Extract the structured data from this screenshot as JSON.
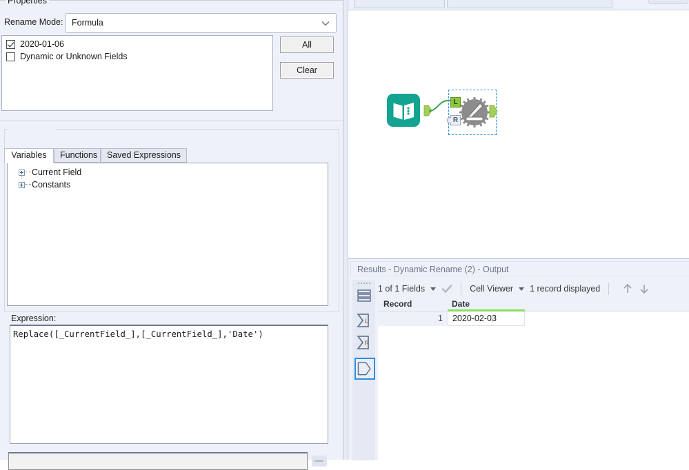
{
  "config": {
    "rename_mode_label": "Rename Mode:",
    "rename_mode_value": "Formula",
    "dropdown_icon": "chevron-down-icon",
    "fields": [
      {
        "label": "2020-01-06",
        "checked": true
      },
      {
        "label": "Dynamic or Unknown Fields",
        "checked": false
      }
    ],
    "buttons": {
      "all": "All",
      "clear": "Clear"
    },
    "properties": {
      "group_title": "Properties",
      "tabs": [
        {
          "label": "Variables",
          "active": true
        },
        {
          "label": "Functions",
          "active": false
        },
        {
          "label": "Saved Expressions",
          "active": false
        }
      ],
      "tree": [
        {
          "label": "Current Field",
          "expander": "plus-icon"
        },
        {
          "label": "Constants",
          "expander": "plus-icon"
        }
      ]
    },
    "expression": {
      "label": "Expression:",
      "value": "Replace([_CurrentField_],[_CurrentField_],'Date')"
    }
  },
  "canvas": {
    "tools": [
      {
        "name": "text-input-tool",
        "icon": "book-icon"
      },
      {
        "name": "dynamic-rename-tool",
        "icon": "gear-pencil-icon",
        "selected": true
      }
    ],
    "anchors": {
      "left_label": "L",
      "right_label": "R"
    }
  },
  "results": {
    "title": "Results - Dynamic Rename (2) - Output",
    "toolbar": {
      "fields_selector": "1 of 1 Fields",
      "check_icon": "check-icon",
      "view_mode": "Cell Viewer",
      "record_count": "1 record displayed",
      "up_icon": "arrow-up-icon",
      "down_icon": "arrow-down-icon"
    },
    "rail_icons": [
      "rows-icon",
      "sum-left-icon",
      "sum-right-icon",
      "output-anchor-icon"
    ],
    "table": {
      "columns": [
        "Record",
        "Date"
      ],
      "rows": [
        {
          "Record": "1",
          "Date": "2020-02-03"
        }
      ]
    }
  },
  "colors": {
    "panel_bg": "#eef1f9",
    "accent_blue": "#2f8fe0",
    "anchor_green": "#8cc63f",
    "field_underline_green": "#8cdd5f",
    "tool_teal": "#13a391",
    "tool_gray": "#8c8c8c"
  }
}
